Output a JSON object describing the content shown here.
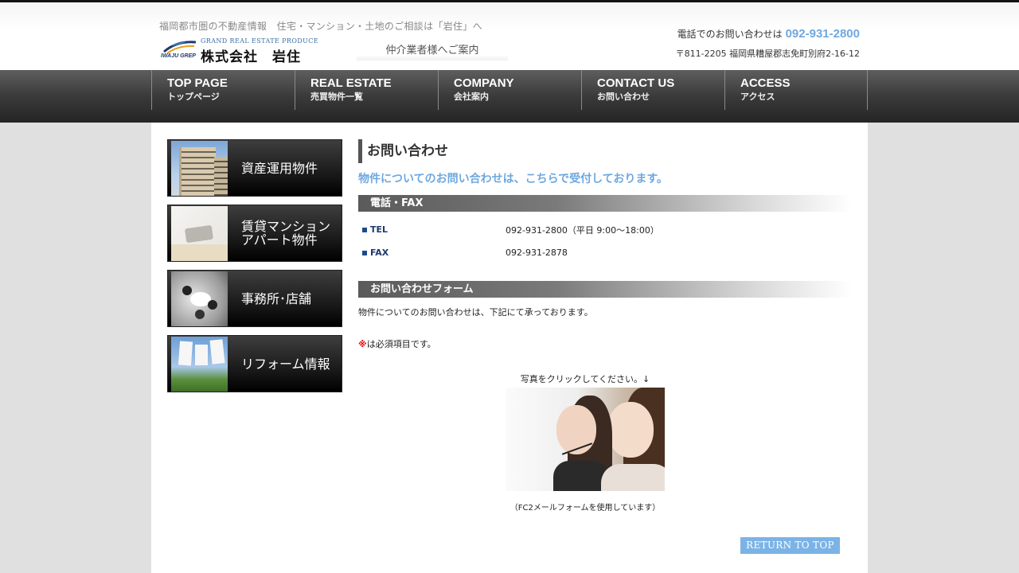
{
  "header": {
    "tagline": "福岡都市圏の不動産情報　住宅・マンション・土地のご相談は「岩住」へ",
    "logo": {
      "brand_en": "GRAND REAL ESTATE PRODUCE",
      "brand_sub": "IWAJU GREP",
      "company_name": "株式会社　岩住"
    },
    "broker_link": "仲介業者様へご案内",
    "phone_label": "電話でのお問い合わせは",
    "phone_number": "092-931-2800",
    "address": "〒811-2205 福岡県糟屋郡志免町別府2-16-12",
    "phone_color": "#6ea8e0"
  },
  "nav": [
    {
      "en": "TOP PAGE",
      "jp": "トップページ"
    },
    {
      "en": "REAL ESTATE",
      "jp": "売買物件一覧"
    },
    {
      "en": "COMPANY",
      "jp": "会社案内"
    },
    {
      "en": "CONTACT US",
      "jp": "お問い合わせ"
    },
    {
      "en": "ACCESS",
      "jp": "アクセス"
    }
  ],
  "sidebar": [
    {
      "label": "資産運用物件",
      "icon": "building-photo"
    },
    {
      "label": "賃貸マンション\nアパート物件",
      "icon": "sofa-room-photo"
    },
    {
      "label": "事務所･店舗",
      "icon": "office-meeting-photo"
    },
    {
      "label": "リフォーム情報",
      "icon": "laundry-sky-photo"
    }
  ],
  "main": {
    "title": "お問い合わせ",
    "lead": "物件についてのお問い合わせは、こちらで受付しております。",
    "phone_section": {
      "heading": "電話・FAX",
      "rows": [
        {
          "key": "TEL",
          "value": "092-931-2800（平日 9:00～18:00）"
        },
        {
          "key": "FAX",
          "value": "092-931-2878"
        }
      ]
    },
    "form_section": {
      "heading": "お問い合わせフォーム",
      "intro": "物件についてのお問い合わせは、下記にて承っております。",
      "required_mark": "※",
      "required_text": "は必須項目です。",
      "photo_caption": "写真をクリックしてください。↓",
      "photo_icon": "call-center-operators-photo",
      "note": "（FC2メールフォームを使用しています）"
    },
    "accent_color": "#6ea8e0"
  },
  "footer": {
    "return_to_top": "RETURN TO TOP",
    "return_color": "#7bb3e6"
  }
}
